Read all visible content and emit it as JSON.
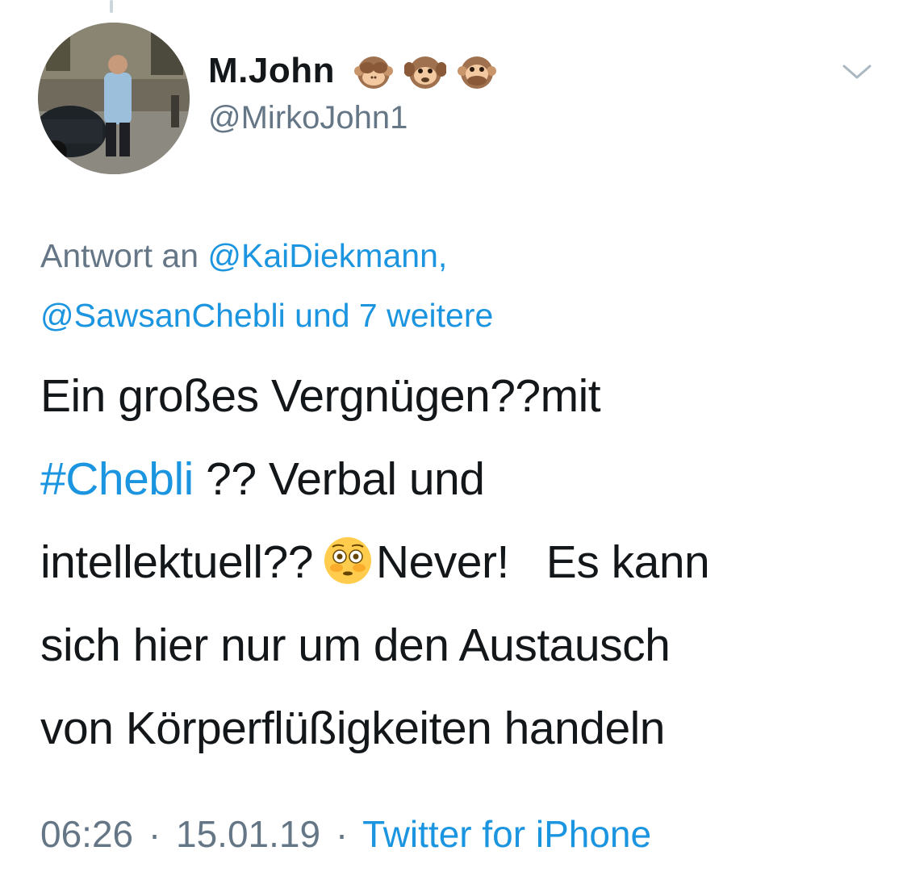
{
  "tweet": {
    "author": {
      "display_name": "M.John",
      "handle": "@MirkoJohn1",
      "name_emojis": [
        "see-no-evil-monkey-icon",
        "see-no-evil-monkey-icon",
        "speak-no-evil-monkey-icon"
      ]
    },
    "reply_to": {
      "prefix": "Antwort an",
      "mention_1": "@KaiDiekmann,",
      "mention_2": "@SawsanChebli",
      "suffix": "und 7 weitere"
    },
    "text": {
      "line1": "Ein großes Vergnügen??mit",
      "hashtag": "#Chebli",
      "line2_rest": " ?? Verbal und",
      "line3_start": "intellektuell??",
      "line3_emoji": "flushed-face-icon",
      "line3_end": "Never!   Es kann",
      "line4": "sich hier nur um den Austausch",
      "line5": "von Körperflüßigkeiten handeln"
    },
    "meta": {
      "time": "06:26",
      "separator": "·",
      "date": "15.01.19",
      "source": "Twitter for iPhone"
    }
  },
  "colors": {
    "link": "#1b95e0",
    "secondary_text": "#657786",
    "primary_text": "#14171a"
  }
}
